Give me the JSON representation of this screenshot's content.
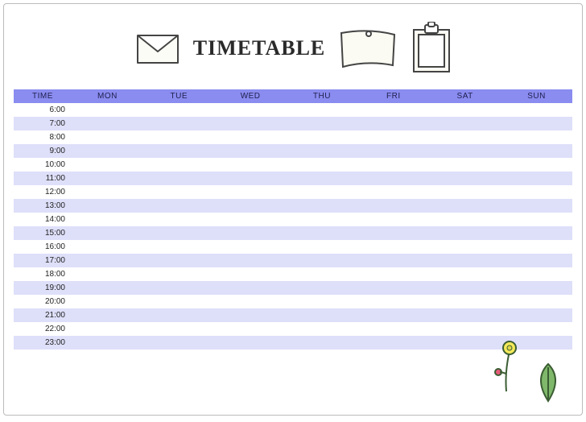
{
  "header": {
    "title": "TIMETABLE"
  },
  "table": {
    "time_header": "TIME",
    "days": [
      "MON",
      "TUE",
      "WED",
      "THU",
      "FRI",
      "SAT",
      "SUN"
    ],
    "times": [
      "6:00",
      "7:00",
      "8:00",
      "9:00",
      "10:00",
      "11:00",
      "12:00",
      "13:00",
      "14:00",
      "15:00",
      "16:00",
      "17:00",
      "18:00",
      "19:00",
      "20:00",
      "21:00",
      "22:00",
      "23:00"
    ]
  }
}
